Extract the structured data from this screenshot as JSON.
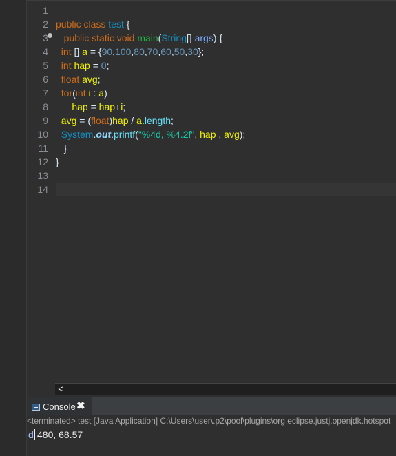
{
  "editor": {
    "line_numbers": [
      "1",
      "2",
      "3",
      "4",
      "5",
      "6",
      "7",
      "8",
      "9",
      "10",
      "11",
      "12",
      "13",
      "14"
    ],
    "code": {
      "l2": {
        "public": "public",
        "class": "class",
        "test": "test",
        "brace": " {"
      },
      "l3": {
        "public": "public",
        "static": "static",
        "void": "void",
        "main": "main",
        "open": "(",
        "String": "String",
        "brackets": "[] ",
        "args": "args",
        "close": ") {"
      },
      "l4": {
        "int": "int",
        "rest_a": " [] ",
        "a": "a",
        "eq": " = {",
        "n1": "90",
        "c1": ",",
        "n2": "100",
        "c2": ",",
        "n3": "80",
        "c3": ",",
        "n4": "70",
        "c4": ",",
        "n5": "60",
        "c5": ",",
        "n6": "50",
        "c6": ",",
        "n7": "30",
        "end": "};"
      },
      "l5": {
        "int": "int",
        "hap": "hap",
        "eq": " = ",
        "zero": "0",
        "end": ";"
      },
      "l6": {
        "float": "float",
        "avg": "avg",
        "end": ";"
      },
      "l7": {
        "for": "for",
        "open": "(",
        "int": "int",
        "i": "i",
        "colon": " : ",
        "a": "a",
        "close": ")"
      },
      "l8": {
        "hap": "hap",
        "eq": " = ",
        "hap2": "hap",
        "plus": "+",
        "i": "i",
        "end": ";"
      },
      "l9": {
        "avg": "avg",
        "eq": " = (",
        "float": "float",
        "close": ")",
        "hap": "hap",
        "div": " / ",
        "a": "a",
        "dot": ".",
        "length": "length",
        "end": ";"
      },
      "l10": {
        "System": "System",
        "dot1": ".",
        "out": "out",
        "dot2": ".",
        "printf": "printf",
        "open": "(",
        "str": "\"%4d, %4.2f\"",
        "comma": ", ",
        "hap": "hap",
        "sep": " , ",
        "avg": "avg",
        "end": ");"
      },
      "l11": {
        "brace": "}"
      },
      "l12": {
        "brace": "}"
      }
    },
    "scroll_left": "<"
  },
  "console": {
    "tab_label": "Console",
    "close_label": "✖",
    "terminated_text": "<terminated> test [Java Application] C:\\Users\\user\\.p2\\pool\\plugins\\org.eclipse.justj.openjdk.hotspot",
    "prefix": "d",
    "output": "480, 68.57"
  },
  "colors": {
    "background": "#2f2f2f",
    "keyword": "#cc6c1d",
    "type": "#1290c3",
    "method": "#1eb540",
    "variable": "#f2f200",
    "number": "#6897bb",
    "string": "#17c6a3"
  }
}
